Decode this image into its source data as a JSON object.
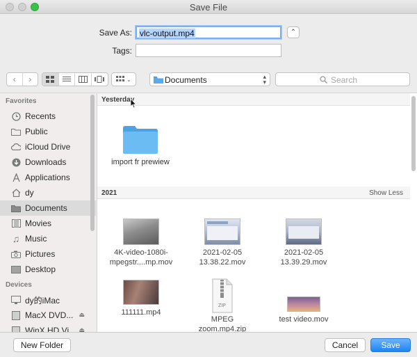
{
  "window": {
    "title": "Save File"
  },
  "form": {
    "save_as_label": "Save As:",
    "save_as_value": "vlc-output.mp4",
    "tags_label": "Tags:",
    "tags_value": ""
  },
  "toolbar": {
    "location": "Documents",
    "search_placeholder": "Search"
  },
  "sidebar": {
    "favorites_header": "Favorites",
    "favorites": [
      {
        "label": "Recents",
        "icon": "clock-icon"
      },
      {
        "label": "Public",
        "icon": "folder-icon"
      },
      {
        "label": "iCloud Drive",
        "icon": "cloud-icon"
      },
      {
        "label": "Downloads",
        "icon": "download-icon"
      },
      {
        "label": "Applications",
        "icon": "applications-icon"
      },
      {
        "label": "dy",
        "icon": "home-icon"
      },
      {
        "label": "Documents",
        "icon": "documents-icon",
        "selected": true
      },
      {
        "label": "Movies",
        "icon": "film-icon"
      },
      {
        "label": "Music",
        "icon": "music-icon"
      },
      {
        "label": "Pictures",
        "icon": "camera-icon"
      },
      {
        "label": "Desktop",
        "icon": "desktop-icon"
      }
    ],
    "devices_header": "Devices",
    "devices": [
      {
        "label": "dy的iMac",
        "icon": "computer-icon"
      },
      {
        "label": "MacX DVD...",
        "icon": "disk-icon"
      },
      {
        "label": "WinX HD Vi...",
        "icon": "disk-icon"
      }
    ]
  },
  "content": {
    "yesterday_header": "Yesterday",
    "folder_label": "import fr prewiew",
    "year_header": "2021",
    "show_less": "Show Less",
    "files": [
      {
        "label": "4K-video-1080i-\nmpegstr....mp.mov"
      },
      {
        "label": "2021-02-05\n13.38.22.mov"
      },
      {
        "label": "2021-02-05\n13.39.29.mov"
      },
      {
        "label": "111111.mp4"
      },
      {
        "label": "MPEG\nzoom.mp4.zip"
      },
      {
        "label": "test video.mov"
      }
    ],
    "zip_badge": "ZIP"
  },
  "footer": {
    "new_folder": "New Folder",
    "cancel": "Cancel",
    "save": "Save"
  },
  "colors": {
    "accent": "#1c84f5",
    "folder": "#63b5f0",
    "close_button": "#3dc14a"
  }
}
